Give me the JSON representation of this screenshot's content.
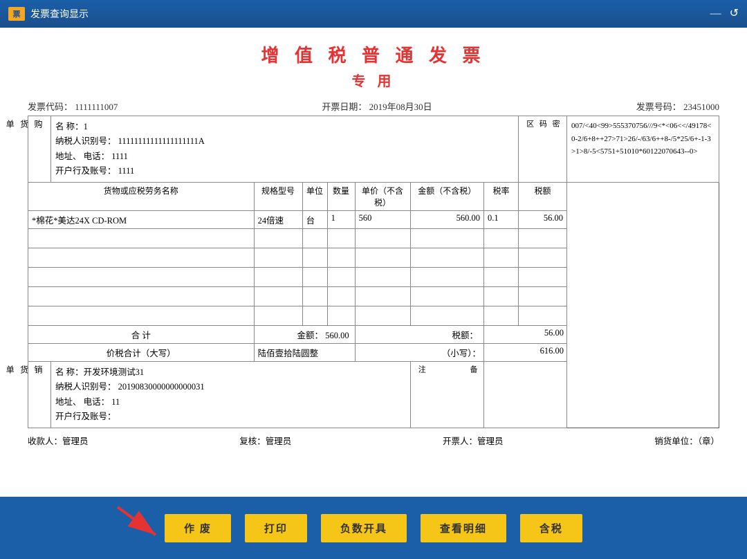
{
  "titleBar": {
    "icon": "票",
    "title": "发票查询显示",
    "minimizeLabel": "—",
    "closeLabel": "↺"
  },
  "invoice": {
    "titleMain": "增 值 税 普 通 发 票",
    "titleSub": "专 用",
    "metaLeft": "发票代码：  1111111007",
    "metaCenter": "开票日期：  2019年08月30日",
    "metaRight": "发票号码：  23451000",
    "buyer": {
      "sideLabel": "购货单位",
      "name": "名    称：1",
      "taxId": "纳税人识别号：  11111111111111111111A",
      "address": "地址、  电话：  1111",
      "bank": "开户行及账号：  1111"
    },
    "secretCode": {
      "label": "密码区",
      "content": "007/<40<99>555370756///9<*<06<</49178<0-2/6+8++27>71>26/-/63/6++8-/5*25/6+-1-3>1>8/-5<5751+51010*60122070643--0>"
    },
    "tableHeaders": {
      "goodsName": "货物或应税劳务名称",
      "spec": "规格型号",
      "unit": "单位",
      "qty": "数量",
      "price": "单价（不含税）",
      "amount": "金额（不含税）",
      "taxRate": "税率",
      "tax": "税额"
    },
    "goodsRows": [
      {
        "name": "*棉花*美达24X CD-ROM",
        "spec": "24倍速",
        "unit": "台",
        "qty": "1",
        "price": "560",
        "amount": "560.00",
        "taxRate": "0.1",
        "tax": "56.00"
      }
    ],
    "summary": {
      "label": "合    计",
      "amountLabel": "金额：",
      "amount": "560.00",
      "taxLabel": "税额：",
      "tax": "56.00"
    },
    "priceTax": {
      "label": "价税合计（大写）",
      "bigAmount": "陆佰壹拾陆圆整",
      "smallLabel": "（小写）：",
      "smallAmount": "616.00"
    },
    "seller": {
      "sideLabel": "销货单位",
      "name": "名    称：开发环境测试31",
      "taxId": "纳税人识别号：  20190830000000000031",
      "address": "地址、  电话：  11",
      "bank": "开户行及账号："
    },
    "notes": {
      "label": "备注"
    },
    "footer": {
      "payee": "收款人：管理员",
      "reviewer": "复核：管理员",
      "drawer": "开票人：管理员",
      "seller": "销货单位：（章）"
    }
  },
  "buttons": {
    "void": "作  废",
    "print": "打印",
    "negative": "负数开具",
    "detail": "查看明细",
    "tax": "含税"
  }
}
